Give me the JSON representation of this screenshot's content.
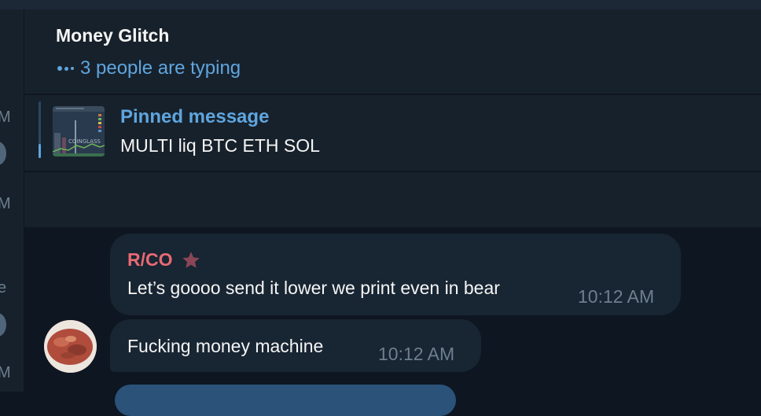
{
  "left_column": {
    "fragments": [
      "M",
      "M",
      "e",
      "M"
    ]
  },
  "header": {
    "title": "Money Glitch",
    "typing_status": "3 people are typing"
  },
  "pinned": {
    "label": "Pinned message",
    "text": "MULTI liq BTC ETH SOL"
  },
  "messages": [
    {
      "sender": "R/CO",
      "text": "Let’s goooo send it lower we print even in bear",
      "time": "10:12 AM"
    },
    {
      "sender": "",
      "text": "Fucking money machine",
      "time": "10:12 AM"
    }
  ],
  "icons": {
    "typing": "typing-dots-icon",
    "admin_badge": "star-icon",
    "pinned_thumbnail": "chart-thumbnail",
    "avatar": "user-avatar"
  },
  "colors": {
    "background": "#0e1621",
    "panel": "#17212b",
    "bubble_incoming": "#182533",
    "bubble_outgoing": "#2b5278",
    "accent": "#5fa5de",
    "sender_name": "#e96a73",
    "star": "#8a4656",
    "time_text": "#6d7f8f",
    "primary_text": "#f5f5f5"
  }
}
